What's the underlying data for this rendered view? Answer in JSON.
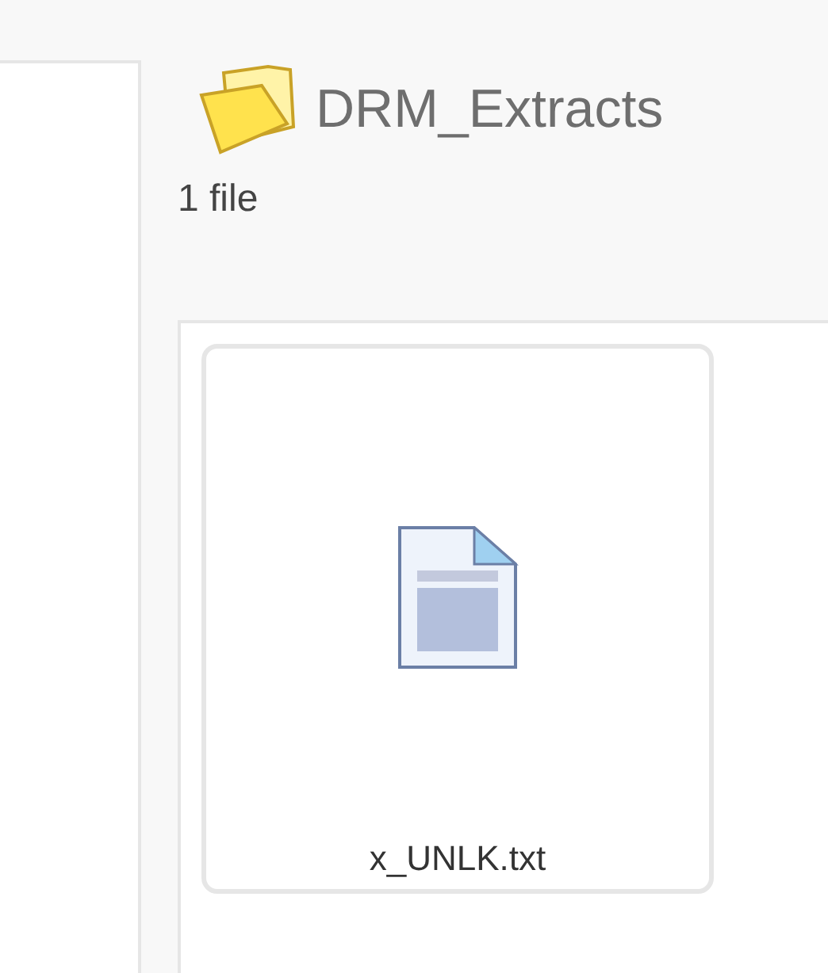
{
  "folder": {
    "title": "DRM_Extracts",
    "count": "1 file"
  },
  "files": [
    {
      "name": "x_UNLK.txt"
    }
  ]
}
